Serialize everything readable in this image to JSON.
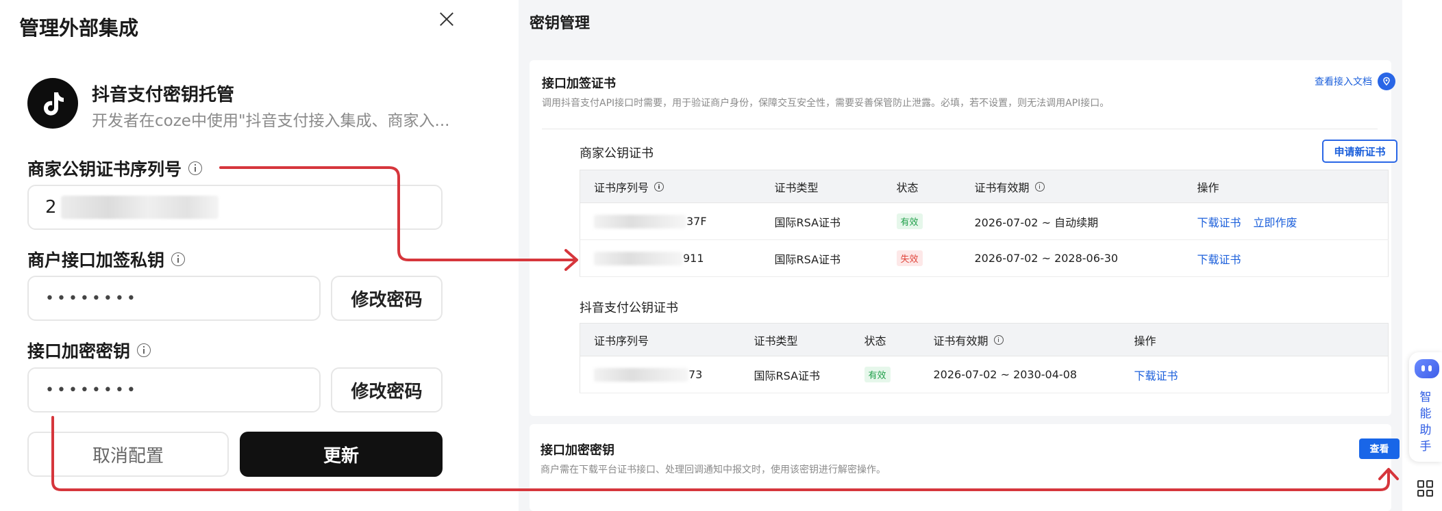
{
  "dialog": {
    "title": "管理外部集成",
    "app": {
      "name": "抖音支付密钥托管",
      "desc": "开发者在coze中使用\"抖音支付接入集成、商家入..."
    },
    "fields": [
      {
        "label": "商家公钥证书序列号",
        "value": "2"
      },
      {
        "label": "商户接口加签私钥",
        "value": "••••••••",
        "action": "修改密码"
      },
      {
        "label": "接口加密密钥",
        "value": "••••••••",
        "action": "修改密码"
      }
    ],
    "cancel_label": "取消配置",
    "submit_label": "更新"
  },
  "panel": {
    "title": "密钥管理",
    "sign_card": {
      "title": "接口加签证书",
      "desc": "调用抖音支付API接口时需要，用于验证商户身份，保障交互安全性，需要妥善保管防止泄露。必填，若不设置，则无法调用API接口。",
      "doc_link": "查看接入文档",
      "merchant": {
        "title": "商家公钥证书",
        "apply_label": "申请新证书",
        "columns": [
          "证书序列号",
          "证书类型",
          "状态",
          "证书有效期",
          "操作"
        ],
        "rows": [
          {
            "serial_suffix": "37F",
            "type": "国际RSA证书",
            "status": "有效",
            "status_kind": "ok",
            "validity": "2026-07-02 ~ 自动续期",
            "actions": [
              "下载证书",
              "立即作废"
            ]
          },
          {
            "serial_suffix": "911",
            "type": "国际RSA证书",
            "status": "失效",
            "status_kind": "bad",
            "validity": "2026-07-02 ~ 2028-06-30",
            "actions": [
              "下载证书"
            ]
          }
        ]
      },
      "platform": {
        "title": "抖音支付公钥证书",
        "columns": [
          "证书序列号",
          "证书类型",
          "状态",
          "证书有效期",
          "操作"
        ],
        "rows": [
          {
            "serial_suffix": "73",
            "type": "国际RSA证书",
            "status": "有效",
            "status_kind": "ok",
            "validity": "2026-07-02 ~ 2030-04-08",
            "actions": [
              "下载证书"
            ]
          }
        ]
      }
    },
    "enc_card": {
      "title": "接口加密密钥",
      "desc": "商户需在下载平台证书接口、处理回调通知中报文时，使用该密钥进行解密操作。",
      "view_label": "查看"
    }
  },
  "assistant": {
    "label": "智能助手",
    "chars": [
      "智",
      "能",
      "助",
      "手"
    ]
  },
  "colors": {
    "accent": "#1966e8",
    "arrow": "#d6363c",
    "dark_button": "#111111",
    "valid": "#22a04b",
    "invalid": "#e0453b"
  },
  "icons": [
    "close-icon",
    "tiktok-logo-icon",
    "info-icon",
    "doc-link-icon",
    "assistant-robot-icon",
    "grid-icon"
  ]
}
